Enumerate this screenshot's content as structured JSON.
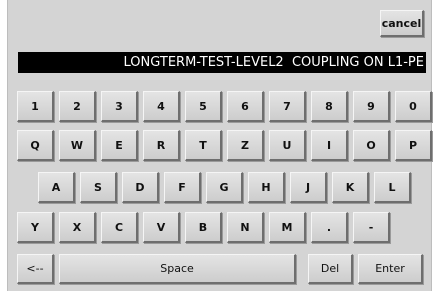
{
  "cancel_label": "cancel",
  "display_text": "LONGTERM-TEST-LEVEL2  COUPLING ON L1-PE",
  "rows": [
    [
      "1",
      "2",
      "3",
      "4",
      "5",
      "6",
      "7",
      "8",
      "9",
      "0"
    ],
    [
      "Q",
      "W",
      "E",
      "R",
      "T",
      "Z",
      "U",
      "I",
      "O",
      "P"
    ],
    [
      "A",
      "S",
      "D",
      "F",
      "G",
      "H",
      "J",
      "K",
      "L"
    ],
    [
      "Y",
      "X",
      "C",
      "V",
      "B",
      "N",
      "M",
      ".",
      "-"
    ]
  ],
  "bottom": {
    "backspace_label": "<--",
    "space_label": "Space",
    "delete_label": "Del",
    "enter_label": "Enter"
  }
}
